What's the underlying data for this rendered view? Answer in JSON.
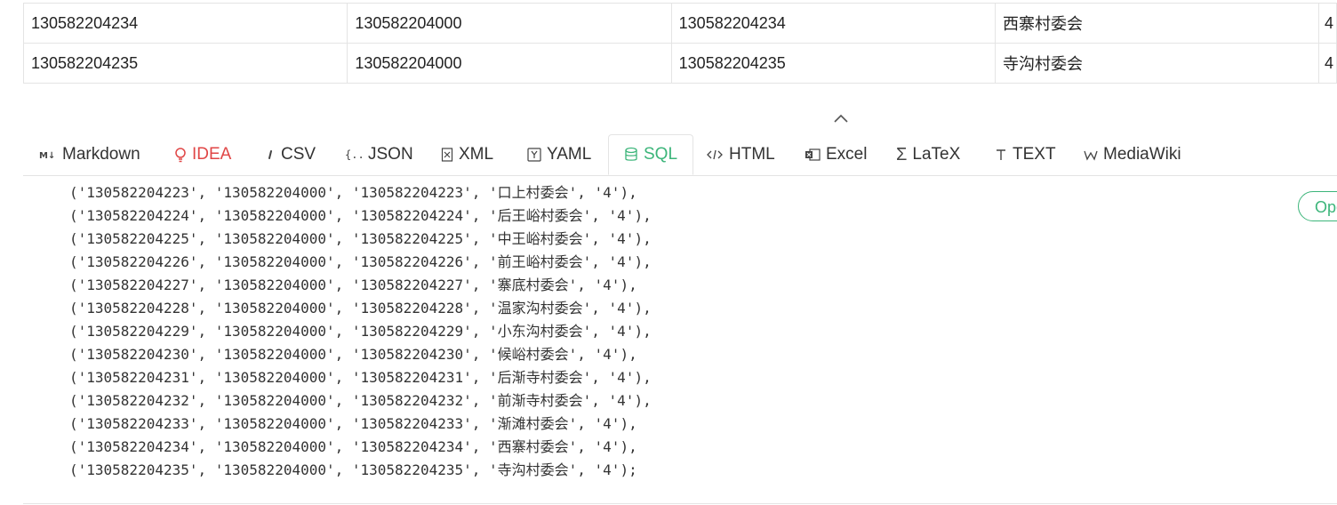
{
  "table": {
    "rows": [
      [
        "130582204234",
        "130582204000",
        "130582204234",
        "西寨村委会",
        "4"
      ],
      [
        "130582204235",
        "130582204000",
        "130582204235",
        "寺沟村委会",
        "4"
      ]
    ]
  },
  "collapse": {
    "icon": "chevron-up-icon"
  },
  "tabs": [
    {
      "label": "Markdown",
      "icon": "markdown-icon"
    },
    {
      "label": "IDEA",
      "icon": "bulb-icon"
    },
    {
      "label": "CSV",
      "icon": "csv-icon"
    },
    {
      "label": "JSON",
      "icon": "json-braces-icon"
    },
    {
      "label": "XML",
      "icon": "xml-file-icon"
    },
    {
      "label": "YAML",
      "icon": "yaml-icon"
    },
    {
      "label": "SQL",
      "icon": "database-icon"
    },
    {
      "label": "HTML",
      "icon": "code-icon"
    },
    {
      "label": "Excel",
      "icon": "excel-icon"
    },
    {
      "label": "LaTeX",
      "icon": "sigma-icon"
    },
    {
      "label": "TEXT",
      "icon": "text-icon"
    },
    {
      "label": "MediaWiki",
      "icon": "wiki-icon"
    }
  ],
  "active_tab": "SQL",
  "colors": {
    "accent": "#3cb57a",
    "idea": "#e04646",
    "border": "#e4e4e4"
  },
  "code_lines": [
    "('130582204223', '130582204000', '130582204223', '口上村委会', '4'),",
    "('130582204224', '130582204000', '130582204224', '后王峪村委会', '4'),",
    "('130582204225', '130582204000', '130582204225', '中王峪村委会', '4'),",
    "('130582204226', '130582204000', '130582204226', '前王峪村委会', '4'),",
    "('130582204227', '130582204000', '130582204227', '寨底村委会', '4'),",
    "('130582204228', '130582204000', '130582204228', '温家沟村委会', '4'),",
    "('130582204229', '130582204000', '130582204229', '小东沟村委会', '4'),",
    "('130582204230', '130582204000', '130582204230', '候峪村委会', '4'),",
    "('130582204231', '130582204000', '130582204231', '后渐寺村委会', '4'),",
    "('130582204232', '130582204000', '130582204232', '前渐寺村委会', '4'),",
    "('130582204233', '130582204000', '130582204233', '渐滩村委会', '4'),",
    "('130582204234', '130582204000', '130582204234', '西寨村委会', '4'),",
    "('130582204235', '130582204000', '130582204235', '寺沟村委会', '4');"
  ],
  "open_button": {
    "label": "Open"
  }
}
